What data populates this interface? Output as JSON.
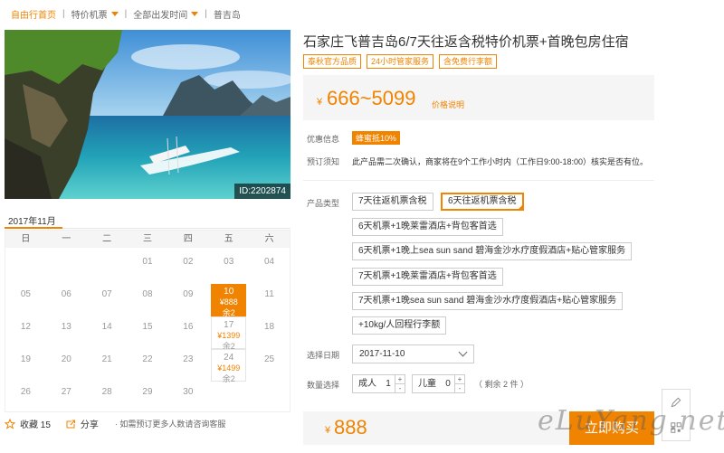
{
  "breadcrumb": {
    "items": [
      "自由行首页",
      "特价机票",
      "全部出发时间",
      "普吉岛"
    ]
  },
  "photo": {
    "id_label": "ID:2202874"
  },
  "calendar": {
    "month_label": "2017年11月",
    "weekdays": [
      "日",
      "一",
      "二",
      "三",
      "四",
      "五",
      "六"
    ],
    "cells": [
      {
        "day": ""
      },
      {
        "day": ""
      },
      {
        "day": ""
      },
      {
        "day": "01"
      },
      {
        "day": "02"
      },
      {
        "day": "03"
      },
      {
        "day": "04"
      },
      {
        "day": "05"
      },
      {
        "day": "06"
      },
      {
        "day": "07"
      },
      {
        "day": "08"
      },
      {
        "day": "09"
      },
      {
        "day": "10",
        "price": "¥888",
        "left": "余2",
        "state": "selected"
      },
      {
        "day": "11"
      },
      {
        "day": "12"
      },
      {
        "day": "13"
      },
      {
        "day": "14"
      },
      {
        "day": "15"
      },
      {
        "day": "16"
      },
      {
        "day": "17",
        "price": "¥1399",
        "left": "余2",
        "state": "avail"
      },
      {
        "day": "18"
      },
      {
        "day": "19"
      },
      {
        "day": "20"
      },
      {
        "day": "21"
      },
      {
        "day": "22"
      },
      {
        "day": "23"
      },
      {
        "day": "24",
        "price": "¥1499",
        "left": "余2",
        "state": "avail"
      },
      {
        "day": "25"
      },
      {
        "day": "26"
      },
      {
        "day": "27"
      },
      {
        "day": "28"
      },
      {
        "day": "29"
      },
      {
        "day": "30"
      }
    ]
  },
  "footer_left": {
    "favorite_label": "收藏 15",
    "share_label": "分享",
    "note": "· 如需预订更多人数请咨询客服"
  },
  "product": {
    "title": "石家庄飞普吉岛6/7天往返含税特价机票+首晚包房住宿",
    "tags": [
      "泰秋官方品质",
      "24小时管家服务",
      "含免费行李额"
    ],
    "price_yen": "¥",
    "price_range": "666~5099",
    "price_explain": "价格说明"
  },
  "info": {
    "discount_label": "优惠信息",
    "discount_value": "蜂蜜抵10%",
    "notice_label": "预订须知",
    "notice_value": "此产品需二次确认，商家将在9个工作小时内（工作日9:00-18:00）核实是否有位。"
  },
  "options": {
    "label": "产品类型",
    "items": [
      "7天往返机票含税",
      "6天往返机票含税",
      "6天机票+1晚莱雷酒店+背包客首选",
      "6天机票+1晚上sea sun sand 碧海金沙水疗度假酒店+贴心管家服务",
      "7天机票+1晚莱雷酒店+背包客首选",
      "7天机票+1晚sea sun sand 碧海金沙水疗度假酒店+贴心管家服务",
      "+10kg/人回程行李额"
    ]
  },
  "date": {
    "label": "选择日期",
    "value": "2017-11-10"
  },
  "quantity": {
    "label": "数量选择",
    "adult_label": "成人",
    "adult_value": "1",
    "child_label": "儿童",
    "child_value": "0",
    "plus": "+",
    "minus": "-",
    "remain": "（ 剩余 2 件 ）"
  },
  "buy": {
    "yen": "¥",
    "total": "888",
    "button_label": "立即购买"
  },
  "watermark": "eLuYang.net",
  "colors": {
    "accent": "#f08300",
    "panel": "#f5f5f5"
  }
}
